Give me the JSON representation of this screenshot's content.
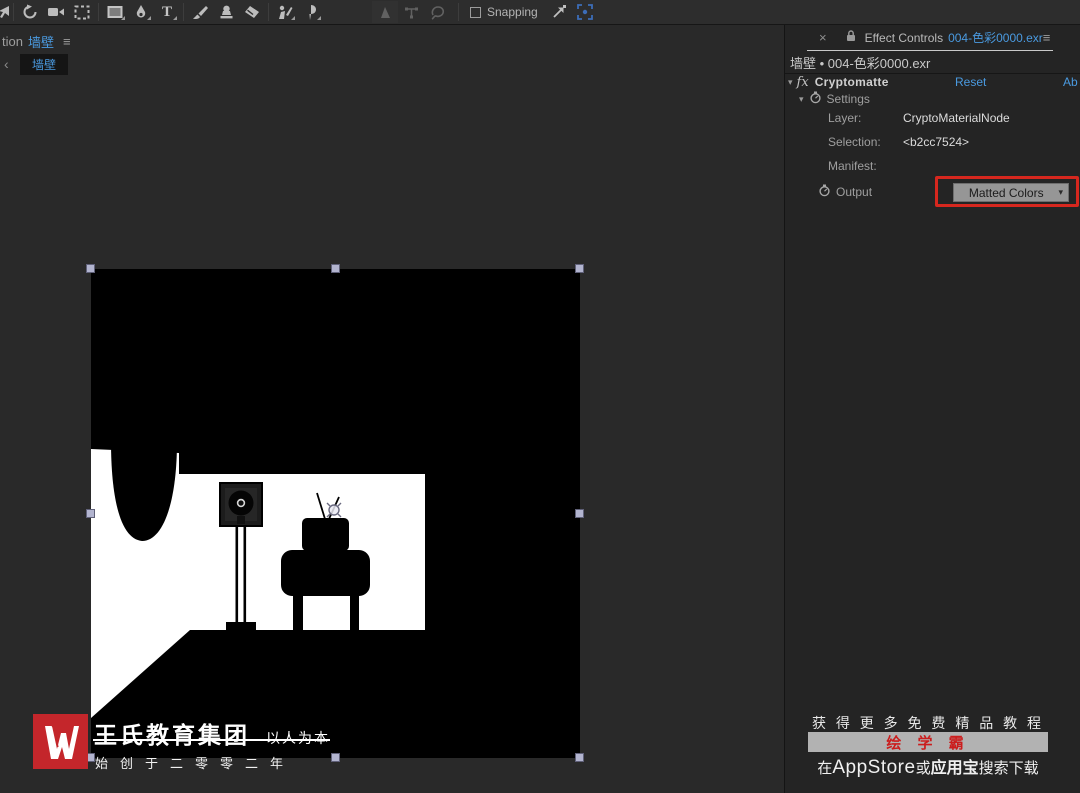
{
  "colors": {
    "accent_blue": "#4a9ae0",
    "annotation_red": "#d6271e",
    "promo_red": "#cb1d1d",
    "logo_red": "#c4262b",
    "handle_lavender": "#b2b4cf"
  },
  "toolbar": {
    "tools": [
      "selection",
      "rotation",
      "camera",
      "region-of-interest",
      "rectangle",
      "pen",
      "type",
      "brush",
      "clone-stamp",
      "eraser",
      "roto-brush",
      "puppet-pin",
      "mask-feather-disabled",
      "convert-vertex-disabled",
      "lasso-disabled",
      "snap-arrow",
      "motion-target"
    ],
    "snapping_label": "Snapping"
  },
  "icons": {
    "close": "×",
    "menu": "≡",
    "back": "‹",
    "twirl_open": "▾",
    "dropdown_chevron": "▾",
    "fx": "fx"
  },
  "comp_panel": {
    "tab_prefix": "tion",
    "tab_name": "墙壁",
    "breadcrumb_name": "墙壁"
  },
  "effect_controls": {
    "tab": {
      "title": "Effect Controls",
      "doc": "004-色彩0000.exr"
    },
    "source_line": "墙壁 • 004-色彩0000.exr",
    "effect": {
      "name": "Cryptomatte",
      "reset_label": "Reset",
      "about_label": "Ab"
    },
    "settings_group_label": "Settings",
    "settings_rows": [
      {
        "label": "Layer:",
        "value": "CryptoMaterialNode"
      },
      {
        "label": "Selection:",
        "value": "<b2cc7524>"
      },
      {
        "label": "Manifest:",
        "value": ""
      }
    ],
    "output": {
      "label": "Output",
      "selected_value": "Matted Colors"
    }
  },
  "watermark": {
    "title": "王氏教育集团",
    "subtitle": "以人为本",
    "line2": "始创于二零零二年"
  },
  "promo": {
    "line1": "获 得 更 多 免 费 精 品 教 程",
    "badge": "绘 学 霸",
    "line3_pre": "在",
    "line3_store": "AppStore",
    "line3_mid": "或",
    "line3_store2": "应用宝",
    "line3_post": "搜索下载"
  }
}
